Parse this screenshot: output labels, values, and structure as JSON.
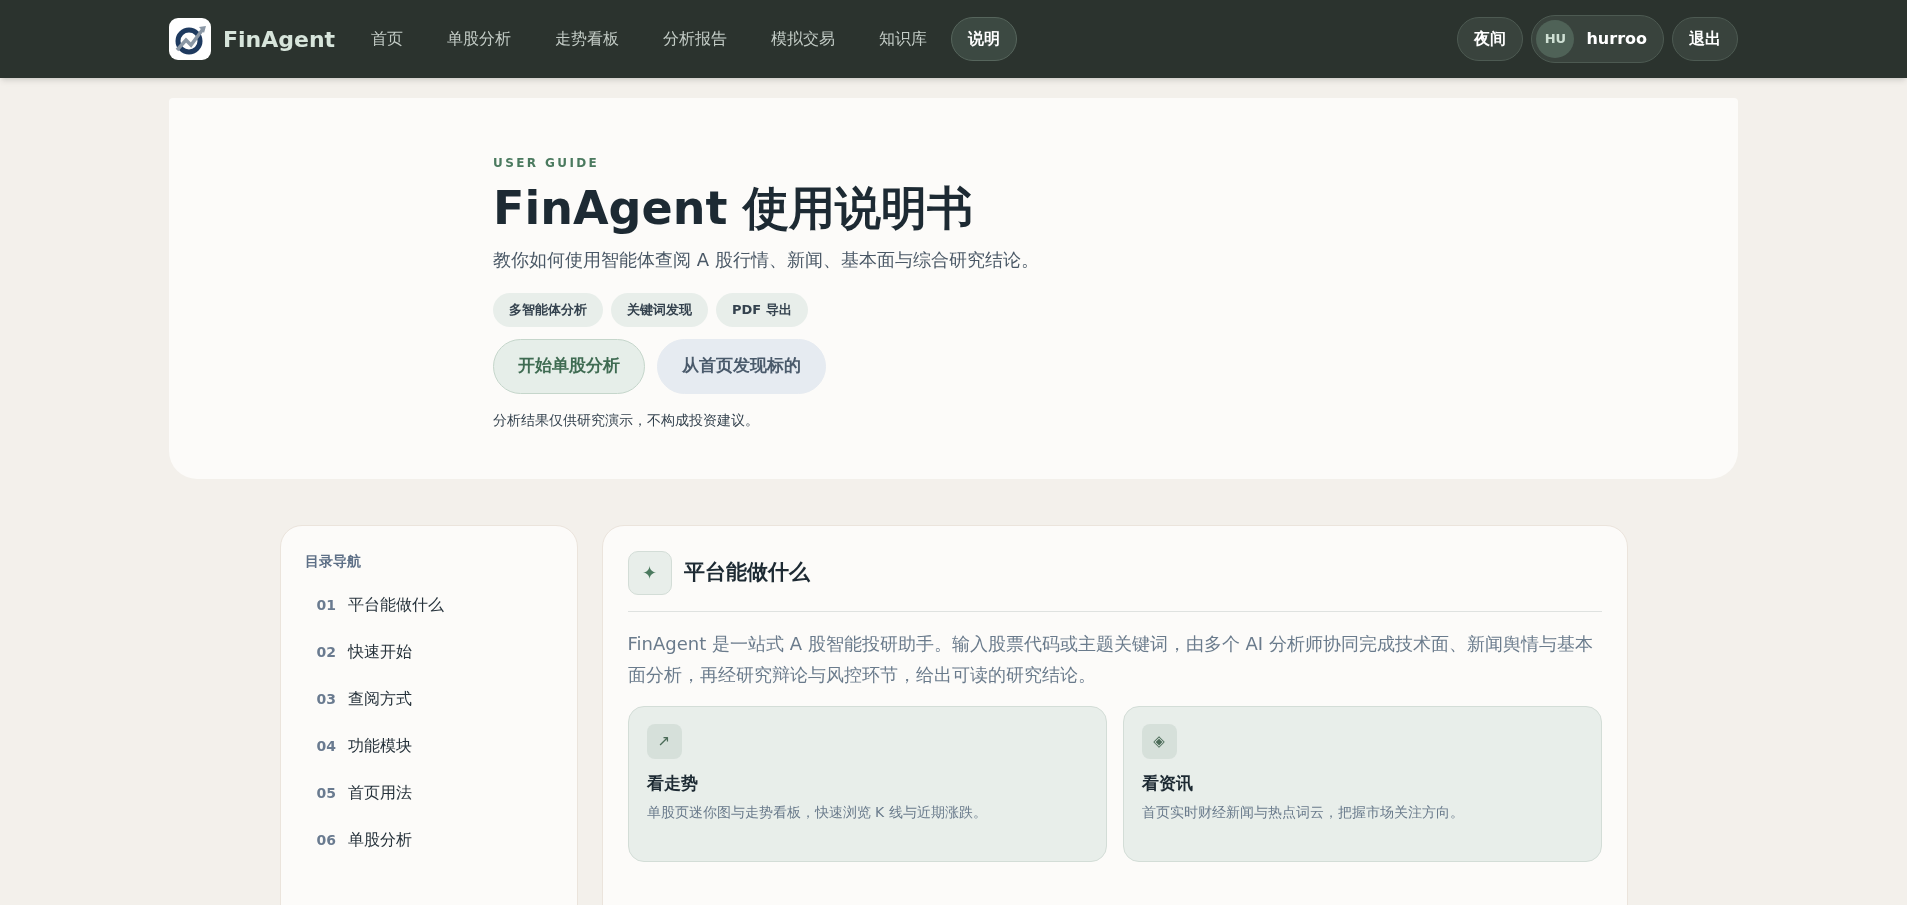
{
  "nav": {
    "brand": "FinAgent",
    "items": [
      {
        "label": "首页",
        "selected": false
      },
      {
        "label": "单股分析",
        "selected": false
      },
      {
        "label": "走势看板",
        "selected": false
      },
      {
        "label": "分析报告",
        "selected": false
      },
      {
        "label": "模拟交易",
        "selected": false
      },
      {
        "label": "知识库",
        "selected": false
      },
      {
        "label": "说明",
        "selected": true
      }
    ],
    "theme_button": "夜间",
    "user": {
      "initials": "HU",
      "name": "hurroo"
    },
    "logout_button": "退出"
  },
  "hero": {
    "eyebrow": "USER GUIDE",
    "title": "FinAgent 使用说明书",
    "subtitle": "教你如何使用智能体查阅 A 股行情、新闻、基本面与综合研究结论。",
    "tags": [
      "多智能体分析",
      "关键词发现",
      "PDF 导出"
    ],
    "buttons": [
      {
        "label": "开始单股分析",
        "kind": "primary"
      },
      {
        "label": "从首页发现标的",
        "kind": "secondary"
      }
    ],
    "note": "分析结果仅供研究演示，不构成投资建议。"
  },
  "toc": {
    "title": "目录导航",
    "items": [
      {
        "number": "01",
        "label": "平台能做什么"
      },
      {
        "number": "02",
        "label": "快速开始"
      },
      {
        "number": "03",
        "label": "查阅方式"
      },
      {
        "number": "04",
        "label": "功能模块"
      },
      {
        "number": "05",
        "label": "首页用法"
      },
      {
        "number": "06",
        "label": "单股分析"
      }
    ]
  },
  "section": {
    "icon": "✦",
    "title": "平台能做什么",
    "intro": "FinAgent 是一站式 A 股智能投研助手。输入股票代码或主题关键词，由多个 AI 分析师协同完成技术面、新闻舆情与基本面分析，再经研究辩论与风控环节，给出可读的研究结论。",
    "features": [
      {
        "icon": "↗",
        "title": "看走势",
        "description": "单股页迷你图与走势看板，快速浏览 K 线与近期涨跌。"
      },
      {
        "icon": "◈",
        "title": "看资讯",
        "description": "首页实时财经新闻与热点词云，把握市场关注方向。"
      }
    ]
  }
}
